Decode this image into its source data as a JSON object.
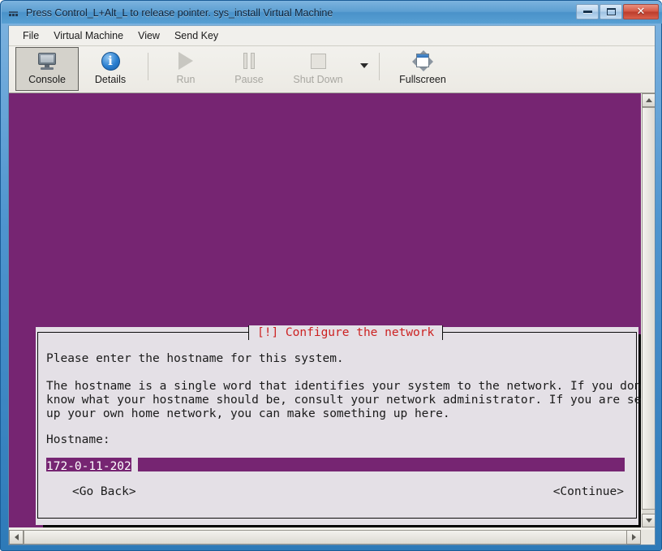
{
  "window": {
    "title": "Press Control_L+Alt_L to release pointer. sys_install Virtual Machine",
    "icon": "virt-manager-icon",
    "controls": {
      "minimize": "minimize-button",
      "maximize": "maximize-button",
      "close_glyph": "✕"
    }
  },
  "menubar": {
    "items": [
      {
        "label": "File"
      },
      {
        "label": "Virtual Machine"
      },
      {
        "label": "View"
      },
      {
        "label": "Send Key"
      }
    ]
  },
  "toolbar": {
    "items": [
      {
        "label": "Console",
        "icon": "monitor-icon",
        "state": "active"
      },
      {
        "label": "Details",
        "icon": "info-icon",
        "state": "enabled"
      },
      {
        "label": "Run",
        "icon": "play-icon",
        "state": "disabled"
      },
      {
        "label": "Pause",
        "icon": "pause-icon",
        "state": "disabled"
      },
      {
        "label": "Shut Down",
        "icon": "stop-icon",
        "state": "disabled"
      },
      {
        "label": "Fullscreen",
        "icon": "fullscreen-icon",
        "state": "enabled"
      }
    ],
    "shutdown_caret": "chevron-down-icon"
  },
  "console": {
    "background_color": "#762572"
  },
  "installer": {
    "title": "[!] Configure the network",
    "title_color": "#cc2222",
    "background_color": "#e4e0e6",
    "intro": "Please enter the hostname for this system.",
    "body": "The hostname is a single word that identifies your system to the network. If you don't\nknow what your hostname should be, consult your network administrator. If you are setting\nup your own home network, you can make something up here.",
    "hostname_label": "Hostname:",
    "hostname_value": "172-0-11-202",
    "hostname_fill": "_______________________________________________________________________________________",
    "buttons": {
      "back": "<Go Back>",
      "continue": "<Continue>"
    }
  },
  "scrollbars": {
    "vertical": {
      "up": "scroll-up-arrow",
      "down": "scroll-down-arrow"
    },
    "horizontal": {
      "left": "scroll-left-arrow",
      "right": "scroll-right-arrow"
    }
  }
}
